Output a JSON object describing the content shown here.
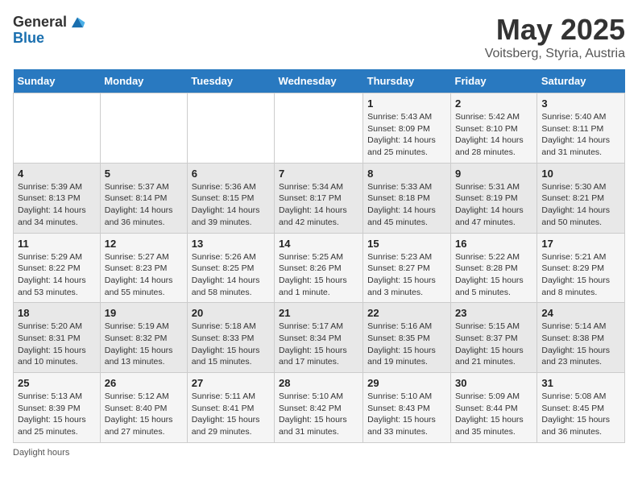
{
  "header": {
    "logo_general": "General",
    "logo_blue": "Blue",
    "title": "May 2025",
    "subtitle": "Voitsberg, Styria, Austria"
  },
  "days_of_week": [
    "Sunday",
    "Monday",
    "Tuesday",
    "Wednesday",
    "Thursday",
    "Friday",
    "Saturday"
  ],
  "weeks": [
    [
      {
        "day": "",
        "sunrise": "",
        "sunset": "",
        "daylight": ""
      },
      {
        "day": "",
        "sunrise": "",
        "sunset": "",
        "daylight": ""
      },
      {
        "day": "",
        "sunrise": "",
        "sunset": "",
        "daylight": ""
      },
      {
        "day": "",
        "sunrise": "",
        "sunset": "",
        "daylight": ""
      },
      {
        "day": "1",
        "sunrise": "Sunrise: 5:43 AM",
        "sunset": "Sunset: 8:09 PM",
        "daylight": "Daylight: 14 hours and 25 minutes."
      },
      {
        "day": "2",
        "sunrise": "Sunrise: 5:42 AM",
        "sunset": "Sunset: 8:10 PM",
        "daylight": "Daylight: 14 hours and 28 minutes."
      },
      {
        "day": "3",
        "sunrise": "Sunrise: 5:40 AM",
        "sunset": "Sunset: 8:11 PM",
        "daylight": "Daylight: 14 hours and 31 minutes."
      }
    ],
    [
      {
        "day": "4",
        "sunrise": "Sunrise: 5:39 AM",
        "sunset": "Sunset: 8:13 PM",
        "daylight": "Daylight: 14 hours and 34 minutes."
      },
      {
        "day": "5",
        "sunrise": "Sunrise: 5:37 AM",
        "sunset": "Sunset: 8:14 PM",
        "daylight": "Daylight: 14 hours and 36 minutes."
      },
      {
        "day": "6",
        "sunrise": "Sunrise: 5:36 AM",
        "sunset": "Sunset: 8:15 PM",
        "daylight": "Daylight: 14 hours and 39 minutes."
      },
      {
        "day": "7",
        "sunrise": "Sunrise: 5:34 AM",
        "sunset": "Sunset: 8:17 PM",
        "daylight": "Daylight: 14 hours and 42 minutes."
      },
      {
        "day": "8",
        "sunrise": "Sunrise: 5:33 AM",
        "sunset": "Sunset: 8:18 PM",
        "daylight": "Daylight: 14 hours and 45 minutes."
      },
      {
        "day": "9",
        "sunrise": "Sunrise: 5:31 AM",
        "sunset": "Sunset: 8:19 PM",
        "daylight": "Daylight: 14 hours and 47 minutes."
      },
      {
        "day": "10",
        "sunrise": "Sunrise: 5:30 AM",
        "sunset": "Sunset: 8:21 PM",
        "daylight": "Daylight: 14 hours and 50 minutes."
      }
    ],
    [
      {
        "day": "11",
        "sunrise": "Sunrise: 5:29 AM",
        "sunset": "Sunset: 8:22 PM",
        "daylight": "Daylight: 14 hours and 53 minutes."
      },
      {
        "day": "12",
        "sunrise": "Sunrise: 5:27 AM",
        "sunset": "Sunset: 8:23 PM",
        "daylight": "Daylight: 14 hours and 55 minutes."
      },
      {
        "day": "13",
        "sunrise": "Sunrise: 5:26 AM",
        "sunset": "Sunset: 8:25 PM",
        "daylight": "Daylight: 14 hours and 58 minutes."
      },
      {
        "day": "14",
        "sunrise": "Sunrise: 5:25 AM",
        "sunset": "Sunset: 8:26 PM",
        "daylight": "Daylight: 15 hours and 1 minute."
      },
      {
        "day": "15",
        "sunrise": "Sunrise: 5:23 AM",
        "sunset": "Sunset: 8:27 PM",
        "daylight": "Daylight: 15 hours and 3 minutes."
      },
      {
        "day": "16",
        "sunrise": "Sunrise: 5:22 AM",
        "sunset": "Sunset: 8:28 PM",
        "daylight": "Daylight: 15 hours and 5 minutes."
      },
      {
        "day": "17",
        "sunrise": "Sunrise: 5:21 AM",
        "sunset": "Sunset: 8:29 PM",
        "daylight": "Daylight: 15 hours and 8 minutes."
      }
    ],
    [
      {
        "day": "18",
        "sunrise": "Sunrise: 5:20 AM",
        "sunset": "Sunset: 8:31 PM",
        "daylight": "Daylight: 15 hours and 10 minutes."
      },
      {
        "day": "19",
        "sunrise": "Sunrise: 5:19 AM",
        "sunset": "Sunset: 8:32 PM",
        "daylight": "Daylight: 15 hours and 13 minutes."
      },
      {
        "day": "20",
        "sunrise": "Sunrise: 5:18 AM",
        "sunset": "Sunset: 8:33 PM",
        "daylight": "Daylight: 15 hours and 15 minutes."
      },
      {
        "day": "21",
        "sunrise": "Sunrise: 5:17 AM",
        "sunset": "Sunset: 8:34 PM",
        "daylight": "Daylight: 15 hours and 17 minutes."
      },
      {
        "day": "22",
        "sunrise": "Sunrise: 5:16 AM",
        "sunset": "Sunset: 8:35 PM",
        "daylight": "Daylight: 15 hours and 19 minutes."
      },
      {
        "day": "23",
        "sunrise": "Sunrise: 5:15 AM",
        "sunset": "Sunset: 8:37 PM",
        "daylight": "Daylight: 15 hours and 21 minutes."
      },
      {
        "day": "24",
        "sunrise": "Sunrise: 5:14 AM",
        "sunset": "Sunset: 8:38 PM",
        "daylight": "Daylight: 15 hours and 23 minutes."
      }
    ],
    [
      {
        "day": "25",
        "sunrise": "Sunrise: 5:13 AM",
        "sunset": "Sunset: 8:39 PM",
        "daylight": "Daylight: 15 hours and 25 minutes."
      },
      {
        "day": "26",
        "sunrise": "Sunrise: 5:12 AM",
        "sunset": "Sunset: 8:40 PM",
        "daylight": "Daylight: 15 hours and 27 minutes."
      },
      {
        "day": "27",
        "sunrise": "Sunrise: 5:11 AM",
        "sunset": "Sunset: 8:41 PM",
        "daylight": "Daylight: 15 hours and 29 minutes."
      },
      {
        "day": "28",
        "sunrise": "Sunrise: 5:10 AM",
        "sunset": "Sunset: 8:42 PM",
        "daylight": "Daylight: 15 hours and 31 minutes."
      },
      {
        "day": "29",
        "sunrise": "Sunrise: 5:10 AM",
        "sunset": "Sunset: 8:43 PM",
        "daylight": "Daylight: 15 hours and 33 minutes."
      },
      {
        "day": "30",
        "sunrise": "Sunrise: 5:09 AM",
        "sunset": "Sunset: 8:44 PM",
        "daylight": "Daylight: 15 hours and 35 minutes."
      },
      {
        "day": "31",
        "sunrise": "Sunrise: 5:08 AM",
        "sunset": "Sunset: 8:45 PM",
        "daylight": "Daylight: 15 hours and 36 minutes."
      }
    ]
  ],
  "footer": {
    "daylight_hours_label": "Daylight hours"
  }
}
